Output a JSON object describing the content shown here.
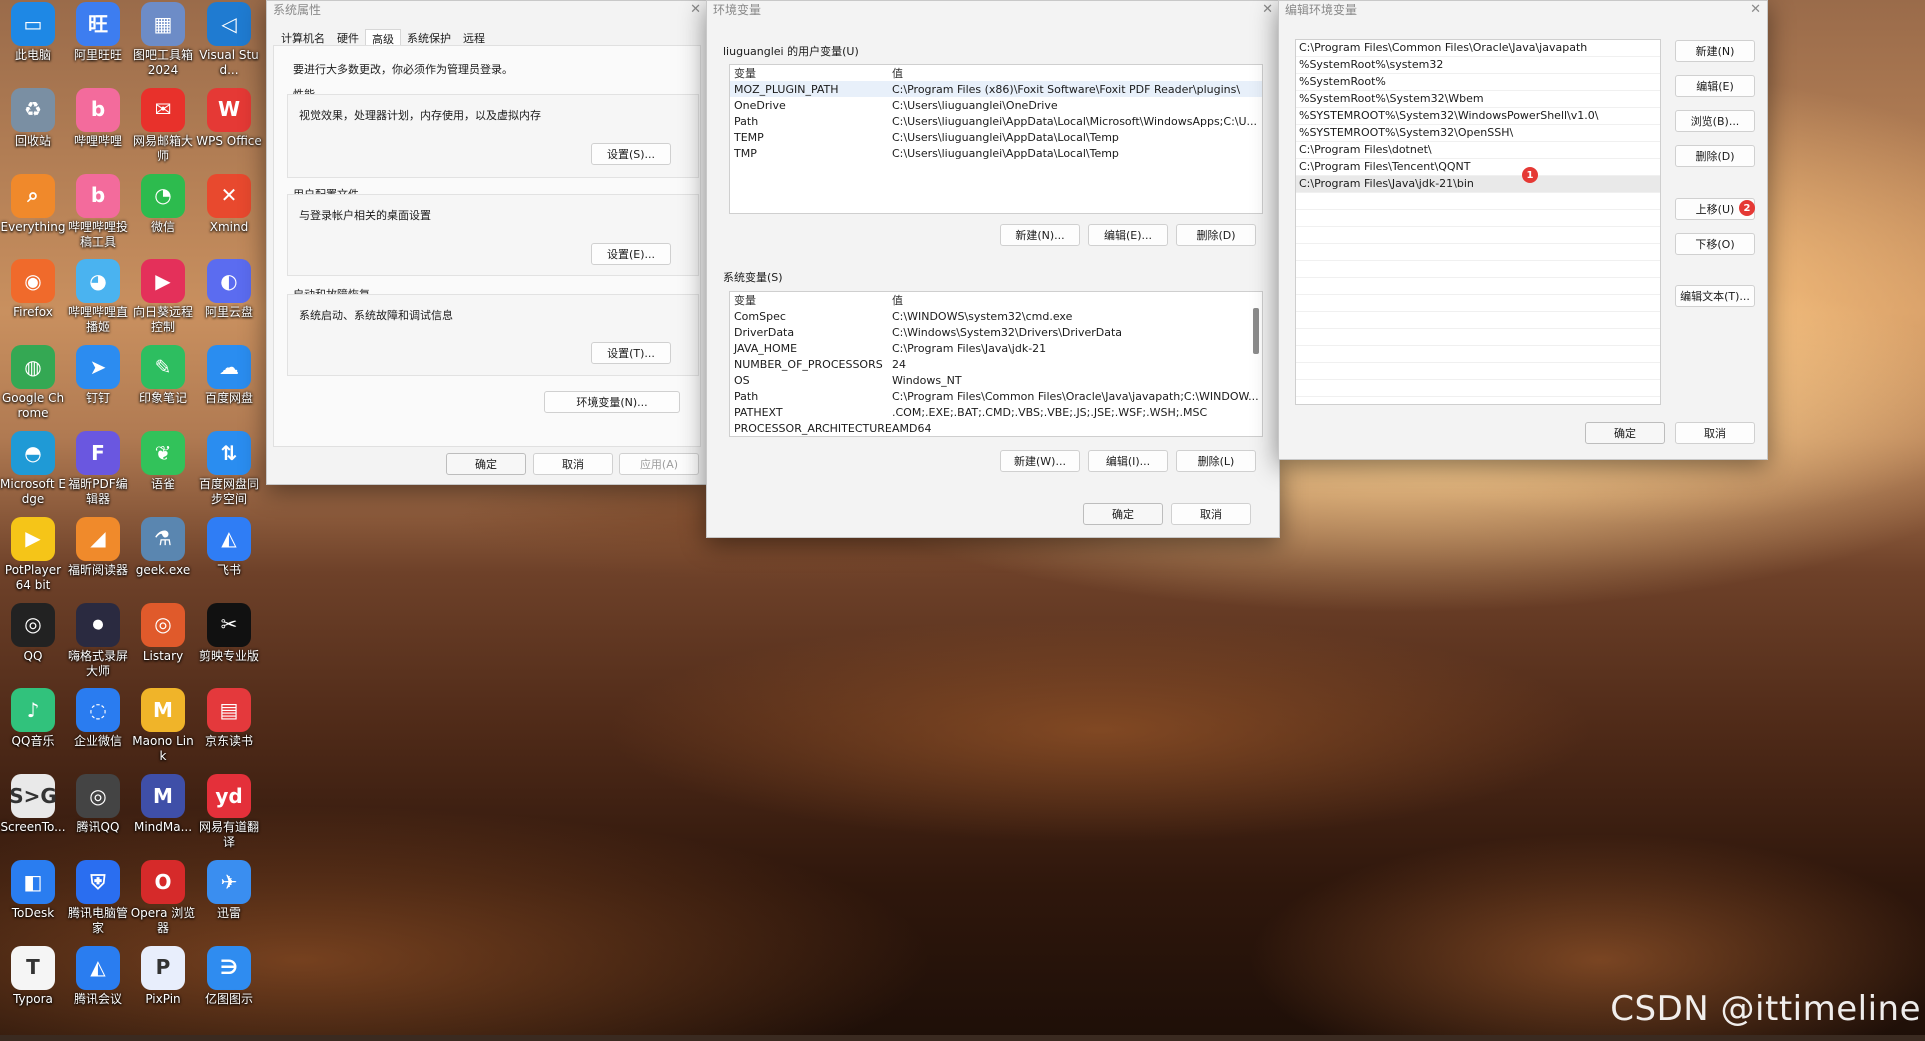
{
  "watermark": "CSDN @ittimeline",
  "desktop_icons": [
    {
      "label": "此电脑",
      "icon": "pc-icon",
      "color": "#1e88e5",
      "glyph": "▭"
    },
    {
      "label": "阿里旺旺",
      "icon": "aliwangwang-icon",
      "color": "#3d7df0",
      "glyph": "旺"
    },
    {
      "label": "图吧工具箱2024",
      "icon": "toolbox-icon",
      "color": "#6d8cc7",
      "glyph": "▦"
    },
    {
      "label": "Visual Stud...",
      "icon": "vscode-icon",
      "color": "#1f7bd1",
      "glyph": "◁"
    },
    {
      "label": "回收站",
      "icon": "recycle-bin-icon",
      "color": "#7a8fa3",
      "glyph": "♻"
    },
    {
      "label": "哔哩哔哩",
      "icon": "bilibili-icon",
      "color": "#f36b9c",
      "glyph": "b"
    },
    {
      "label": "网易邮箱大师",
      "icon": "netease-mail-icon",
      "color": "#e8312b",
      "glyph": "✉"
    },
    {
      "label": "WPS Office",
      "icon": "wps-icon",
      "color": "#e53935",
      "glyph": "W"
    },
    {
      "label": "Everything",
      "icon": "everything-search-icon",
      "color": "#f0892b",
      "glyph": "⌕"
    },
    {
      "label": "哔哩哔哩投稿工具",
      "icon": "bilibili-upload-icon",
      "color": "#f36b9c",
      "glyph": "b"
    },
    {
      "label": "微信",
      "icon": "wechat-icon",
      "color": "#2dbb4e",
      "glyph": "◔"
    },
    {
      "label": "Xmind",
      "icon": "xmind-icon",
      "color": "#e8492e",
      "glyph": "✕"
    },
    {
      "label": "Firefox",
      "icon": "firefox-icon",
      "color": "#f06a2b",
      "glyph": "◉"
    },
    {
      "label": "哔哩哔哩直播姬",
      "icon": "bilibili-live-icon",
      "color": "#4ab3f0",
      "glyph": "◕"
    },
    {
      "label": "向日葵远程控制",
      "icon": "sunflower-icon",
      "color": "#e4305a",
      "glyph": "▶"
    },
    {
      "label": "阿里云盘",
      "icon": "aliyun-drive-icon",
      "color": "#5b6cf0",
      "glyph": "◐"
    },
    {
      "label": "Google Chrome",
      "icon": "chrome-icon",
      "color": "#34a853",
      "glyph": "◍"
    },
    {
      "label": "钉钉",
      "icon": "dingtalk-icon",
      "color": "#2c8cf0",
      "glyph": "➤"
    },
    {
      "label": "印象笔记",
      "icon": "evernote-icon",
      "color": "#2dbe60",
      "glyph": "✎"
    },
    {
      "label": "百度网盘",
      "icon": "baidu-netdisk-icon",
      "color": "#2a8df0",
      "glyph": "☁"
    },
    {
      "label": "Microsoft Edge",
      "icon": "edge-icon",
      "color": "#1f9ad6",
      "glyph": "◓"
    },
    {
      "label": "福昕PDF编辑器",
      "icon": "foxit-pdf-icon",
      "color": "#6a57e0",
      "glyph": "F"
    },
    {
      "label": "语雀",
      "icon": "yuque-icon",
      "color": "#32c25a",
      "glyph": "❦"
    },
    {
      "label": "百度网盘同步空间",
      "icon": "baidu-sync-icon",
      "color": "#2a8df0",
      "glyph": "⇅"
    },
    {
      "label": "PotPlayer 64 bit",
      "icon": "potplayer-icon",
      "color": "#f5c518",
      "glyph": "▶"
    },
    {
      "label": "福昕阅读器",
      "icon": "foxit-reader-icon",
      "color": "#f08a2b",
      "glyph": "◢"
    },
    {
      "label": "geek.exe",
      "icon": "geek-uninstaller-icon",
      "color": "#5a86b0",
      "glyph": "⚗"
    },
    {
      "label": "飞书",
      "icon": "feishu-icon",
      "color": "#2f7df5",
      "glyph": "◭"
    },
    {
      "label": "QQ",
      "icon": "qq-icon",
      "color": "#222222",
      "glyph": "◎"
    },
    {
      "label": "嗨格式录屏大师",
      "icon": "screen-recorder-icon",
      "color": "#2a2a40",
      "glyph": "⏺"
    },
    {
      "label": "Listary",
      "icon": "listary-icon",
      "color": "#e05a2b",
      "glyph": "◎"
    },
    {
      "label": "剪映专业版",
      "icon": "capcut-icon",
      "color": "#111111",
      "glyph": "✂"
    },
    {
      "label": "QQ音乐",
      "icon": "qq-music-icon",
      "color": "#31c27c",
      "glyph": "♪"
    },
    {
      "label": "企业微信",
      "icon": "wecom-icon",
      "color": "#2a7cf0",
      "glyph": "◌"
    },
    {
      "label": "Maono Link",
      "icon": "maono-link-icon",
      "color": "#f0b429",
      "glyph": "M"
    },
    {
      "label": "京东读书",
      "icon": "jd-read-icon",
      "color": "#e4393c",
      "glyph": "▤"
    },
    {
      "label": "ScreenTo...",
      "icon": "screentogif-icon",
      "color": "#e9e9e9",
      "glyph": "S>G"
    },
    {
      "label": "腾讯QQ",
      "icon": "tencent-qq-icon",
      "color": "#444444",
      "glyph": "◎"
    },
    {
      "label": "MindMa...",
      "icon": "mindmanager-icon",
      "color": "#3f4fa8",
      "glyph": "M"
    },
    {
      "label": "网易有道翻译",
      "icon": "youdao-icon",
      "color": "#e4303a",
      "glyph": "yd"
    },
    {
      "label": "ToDesk",
      "icon": "todesk-icon",
      "color": "#2a7df0",
      "glyph": "◧"
    },
    {
      "label": "腾讯电脑管家",
      "icon": "tencent-pcmgr-icon",
      "color": "#2a6ef0",
      "glyph": "⛨"
    },
    {
      "label": "Opera 浏览器",
      "icon": "opera-icon",
      "color": "#d62a2a",
      "glyph": "O"
    },
    {
      "label": "迅雷",
      "icon": "xunlei-icon",
      "color": "#3a8ef0",
      "glyph": "✈"
    },
    {
      "label": "Typora",
      "icon": "typora-icon",
      "color": "#f5f5f5",
      "glyph": "T"
    },
    {
      "label": "腾讯会议",
      "icon": "tencent-meeting-icon",
      "color": "#2a7df0",
      "glyph": "◭"
    },
    {
      "label": "PixPin",
      "icon": "pixpin-icon",
      "color": "#e8eefc",
      "glyph": "P"
    },
    {
      "label": "亿图图示",
      "icon": "edraw-icon",
      "color": "#2f8cf0",
      "glyph": "∋"
    }
  ],
  "sysprops": {
    "title": "系统属性",
    "tabs": [
      "计算机名",
      "硬件",
      "高级",
      "系统保护",
      "远程"
    ],
    "admin_note": "要进行大多数更改，你必须作为管理员登录。",
    "perf_title": "性能",
    "perf_desc": "视觉效果，处理器计划，内存使用，以及虚拟内存",
    "perf_btn": "设置(S)...",
    "profile_title": "用户配置文件",
    "profile_desc": "与登录帐户相关的桌面设置",
    "profile_btn": "设置(E)...",
    "startup_title": "启动和故障恢复",
    "startup_desc": "系统启动、系统故障和调试信息",
    "startup_btn": "设置(T)...",
    "envvar_btn": "环境变量(N)...",
    "ok": "确定",
    "cancel": "取消",
    "apply": "应用(A)"
  },
  "envvars": {
    "title": "环境变量",
    "user_label": "liuguanglei 的用户变量(U)",
    "col_var": "变量",
    "col_val": "值",
    "user_vars": [
      {
        "name": "MOZ_PLUGIN_PATH",
        "value": "C:\\Program Files (x86)\\Foxit Software\\Foxit PDF Reader\\plugins\\"
      },
      {
        "name": "OneDrive",
        "value": "C:\\Users\\liuguanglei\\OneDrive"
      },
      {
        "name": "Path",
        "value": "C:\\Users\\liuguanglei\\AppData\\Local\\Microsoft\\WindowsApps;C:\\U..."
      },
      {
        "name": "TEMP",
        "value": "C:\\Users\\liuguanglei\\AppData\\Local\\Temp"
      },
      {
        "name": "TMP",
        "value": "C:\\Users\\liuguanglei\\AppData\\Local\\Temp"
      }
    ],
    "user_new": "新建(N)...",
    "user_edit": "编辑(E)...",
    "user_delete": "删除(D)",
    "sys_label": "系统变量(S)",
    "sys_vars": [
      {
        "name": "ComSpec",
        "value": "C:\\WINDOWS\\system32\\cmd.exe"
      },
      {
        "name": "DriverData",
        "value": "C:\\Windows\\System32\\Drivers\\DriverData"
      },
      {
        "name": "JAVA_HOME",
        "value": "C:\\Program Files\\Java\\jdk-21"
      },
      {
        "name": "NUMBER_OF_PROCESSORS",
        "value": "24"
      },
      {
        "name": "OS",
        "value": "Windows_NT"
      },
      {
        "name": "Path",
        "value": "C:\\Program Files\\Common Files\\Oracle\\Java\\javapath;C:\\WINDOW..."
      },
      {
        "name": "PATHEXT",
        "value": ".COM;.EXE;.BAT;.CMD;.VBS;.VBE;.JS;.JSE;.WSF;.WSH;.MSC"
      },
      {
        "name": "PROCESSOR_ARCHITECTURE",
        "value": "AMD64"
      }
    ],
    "sys_new": "新建(W)...",
    "sys_edit": "编辑(I)...",
    "sys_delete": "删除(L)",
    "ok": "确定",
    "cancel": "取消"
  },
  "editenv": {
    "title": "编辑环境变量",
    "paths": [
      "C:\\Program Files\\Common Files\\Oracle\\Java\\javapath",
      "%SystemRoot%\\system32",
      "%SystemRoot%",
      "%SystemRoot%\\System32\\Wbem",
      "%SYSTEMROOT%\\System32\\WindowsPowerShell\\v1.0\\",
      "%SYSTEMROOT%\\System32\\OpenSSH\\",
      "C:\\Program Files\\dotnet\\",
      "C:\\Program Files\\Tencent\\QQNT",
      "C:\\Program Files\\Java\\jdk-21\\bin"
    ],
    "badge1": "1",
    "badge2": "2",
    "new": "新建(N)",
    "edit": "编辑(E)",
    "browse": "浏览(B)...",
    "delete": "删除(D)",
    "move_up": "上移(U)",
    "move_down": "下移(O)",
    "edit_text": "编辑文本(T)...",
    "ok": "确定",
    "cancel": "取消"
  }
}
